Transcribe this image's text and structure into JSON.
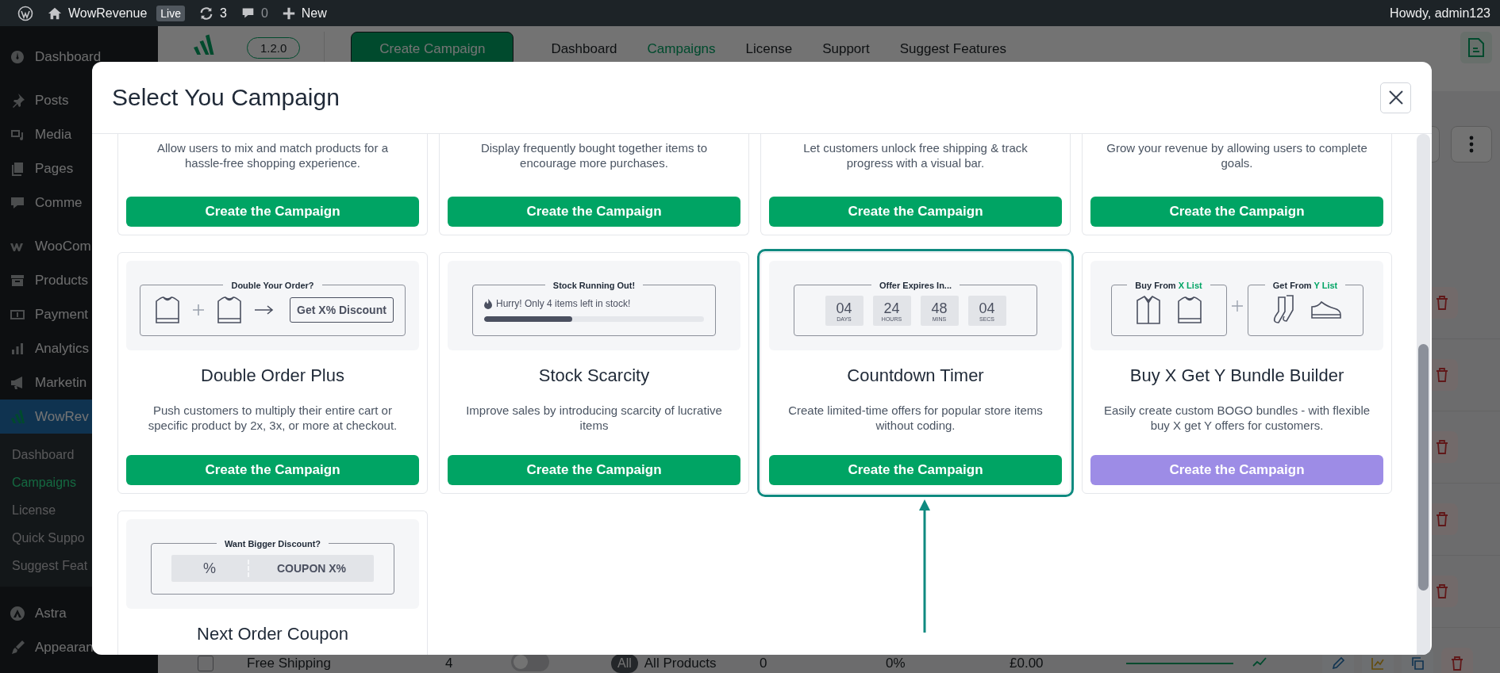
{
  "admin_bar": {
    "site": "WowRevenue",
    "badge": "Live",
    "updates": "3",
    "comments": "0",
    "new": "New",
    "greeting": "Howdy, admin123"
  },
  "sidebar": {
    "groups": [
      [
        {
          "label": "Dashboard",
          "selected": false
        }
      ],
      [
        {
          "label": "Posts",
          "selected": false
        },
        {
          "label": "Media",
          "selected": false
        },
        {
          "label": "Pages",
          "selected": false
        },
        {
          "label": "Comme",
          "selected": false
        }
      ],
      [
        {
          "label": "WooCom",
          "selected": false
        },
        {
          "label": "Products",
          "selected": false
        },
        {
          "label": "Payment",
          "selected": false
        },
        {
          "label": "Analytics",
          "selected": false
        },
        {
          "label": "Marketin",
          "selected": false
        },
        {
          "label": "WowRev",
          "selected": true,
          "children": [
            {
              "label": "Dashboard",
              "selected": false
            },
            {
              "label": "Campaigns",
              "selected": true
            },
            {
              "label": "License",
              "selected": false
            },
            {
              "label": "Quick Suppo",
              "selected": false
            },
            {
              "label": "Suggest Feat",
              "selected": false
            }
          ]
        }
      ],
      [
        {
          "label": "Astra",
          "selected": false
        },
        {
          "label": "Appearan",
          "selected": false
        }
      ]
    ]
  },
  "page_header": {
    "version": "1.2.0",
    "primary_button": "Create Campaign",
    "tabs": [
      {
        "label": "Dashboard",
        "selected": false
      },
      {
        "label": "Campaigns",
        "selected": true
      },
      {
        "label": "License",
        "selected": false
      },
      {
        "label": "Support",
        "selected": false
      },
      {
        "label": "Suggest Features",
        "selected": false
      }
    ]
  },
  "table": {
    "rows": [
      {
        "checked": false,
        "name": "Free Shipping",
        "column_2": "4",
        "enabled": false,
        "scope_badge": "All",
        "scope": "All Products",
        "column_5": "0",
        "column_6": "0%",
        "column_7": "£0.00"
      }
    ]
  },
  "modal": {
    "title": "Select You Campaign",
    "cards": [
      {
        "description": "Allow users to mix and match products for a hassle-free shopping experience.",
        "button": "Create the Campaign",
        "button_disabled": false,
        "selected": false
      },
      {
        "description": "Display frequently bought together items to encourage more purchases.",
        "button": "Create the Campaign",
        "button_disabled": false,
        "selected": false
      },
      {
        "description": "Let customers unlock free shipping & track progress with a visual bar.",
        "button": "Create the Campaign",
        "button_disabled": false,
        "selected": false
      },
      {
        "description": "Grow your revenue by allowing users to complete goals.",
        "button": "Create the Campaign",
        "button_disabled": false,
        "selected": false
      },
      {
        "title": "Double Order Plus",
        "description": "Push customers to multiply their entire cart or specific product by 2x, 3x, or more at checkout.",
        "button": "Create the Campaign",
        "button_disabled": false,
        "selected": false,
        "illustration": {
          "kind": "double_order",
          "heading": "Double Your Order?",
          "offer": "Get X% Discount"
        }
      },
      {
        "title": "Stock Scarcity",
        "description": "Improve sales by introducing scarcity of lucrative items",
        "button": "Create the Campaign",
        "button_disabled": false,
        "selected": false,
        "illustration": {
          "kind": "stock_bar",
          "heading": "Stock Running Out!",
          "message": "Hurry! Only 4 items left in stock!",
          "level": 0.4
        }
      },
      {
        "title": "Countdown Timer",
        "description": "Create limited-time offers for popular store items without coding.",
        "button": "Create the Campaign",
        "button_disabled": false,
        "selected": true,
        "illustration": {
          "kind": "countdown",
          "heading": "Offer Expires In...",
          "units": [
            {
              "value": "04",
              "label": "DAYS"
            },
            {
              "value": "24",
              "label": "HOURS"
            },
            {
              "value": "48",
              "label": "MINS"
            },
            {
              "value": "04",
              "label": "SECS"
            }
          ]
        }
      },
      {
        "title": "Buy X Get Y Bundle Builder",
        "description": "Easily create custom BOGO bundles - with flexible buy X get Y offers for customers.",
        "button": "Create the Campaign",
        "button_disabled": true,
        "selected": false,
        "illustration": {
          "kind": "bundle",
          "groups": [
            {
              "prefix": "Buy From",
              "highlight": "X List"
            },
            {
              "prefix": "Get From",
              "highlight": "Y List"
            }
          ]
        }
      },
      {
        "title": "Next Order Coupon",
        "selected": false,
        "illustration": {
          "kind": "coupon",
          "heading": "Want Bigger Discount?",
          "symbol": "%",
          "code": "COUPON X%"
        }
      }
    ]
  }
}
